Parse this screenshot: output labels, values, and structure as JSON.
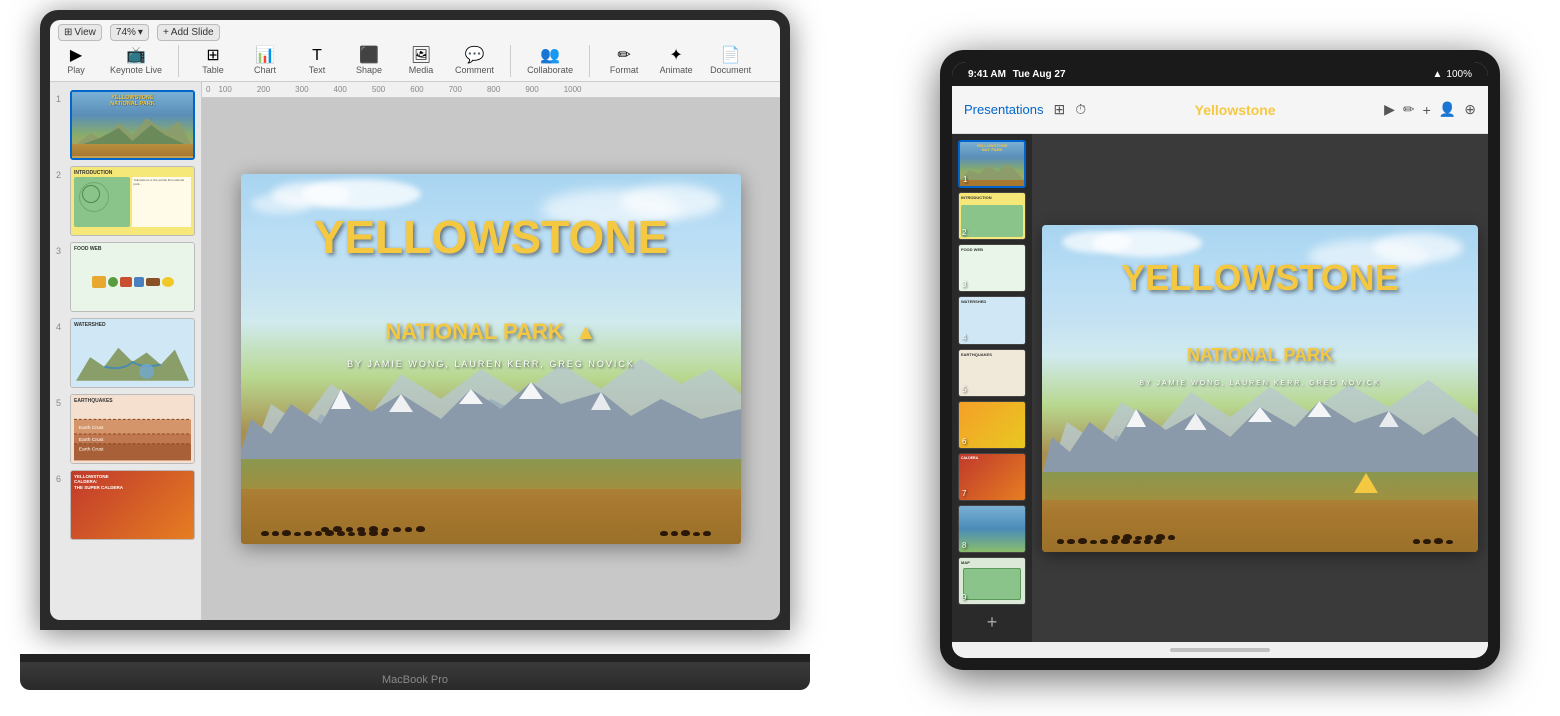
{
  "macbook": {
    "label": "MacBook Pro",
    "toolbar": {
      "view_label": "View",
      "zoom_label": "74%",
      "add_slide_label": "Add Slide",
      "play_label": "Play",
      "keynote_live_label": "Keynote Live",
      "table_label": "Table",
      "chart_label": "Chart",
      "text_label": "Text",
      "shape_label": "Shape",
      "media_label": "Media",
      "comment_label": "Comment",
      "collaborate_label": "Collaborate",
      "format_label": "Format",
      "animate_label": "Animate",
      "document_label": "Document"
    },
    "ruler": {
      "marks": [
        "100",
        "200",
        "300",
        "400",
        "500",
        "600",
        "700",
        "800",
        "900",
        "1000"
      ]
    },
    "slides": [
      {
        "num": "1",
        "label": "YELLOWSTONE NATIONAL PARK",
        "type": "title"
      },
      {
        "num": "2",
        "label": "INTRODUCTION",
        "type": "intro"
      },
      {
        "num": "3",
        "label": "FOOD WEB",
        "type": "food"
      },
      {
        "num": "4",
        "label": "WATERSHED",
        "type": "watershed"
      },
      {
        "num": "5",
        "label": "EARTHQUAKES",
        "type": "earthquakes"
      },
      {
        "num": "6",
        "label": "YELLOWSTONE CALDERA: THE SUPER CALDERA",
        "type": "caldera"
      }
    ],
    "main_slide": {
      "title": "YELLOWSTONE",
      "subtitle": "NATIONAL PARK",
      "triangle": "▲",
      "byline": "BY JAMIE WONG, LAUREN KERR, GREG NOVICK"
    }
  },
  "ipad": {
    "status_bar": {
      "time": "9:41 AM",
      "date": "Tue Aug 27",
      "battery": "100%",
      "wifi": "WiFi"
    },
    "toolbar": {
      "presentations_label": "Presentations",
      "document_title": "Yellowstone"
    },
    "slides": [
      {
        "num": "1",
        "type": "title"
      },
      {
        "num": "2",
        "type": "intro"
      },
      {
        "num": "3",
        "type": "food"
      },
      {
        "num": "4",
        "type": "watershed"
      },
      {
        "num": "5",
        "type": "earthquakes"
      },
      {
        "num": "6",
        "type": "geothermal"
      },
      {
        "num": "7",
        "type": "caldera"
      },
      {
        "num": "8",
        "type": "geothermal2"
      },
      {
        "num": "9",
        "type": "map"
      }
    ],
    "main_slide": {
      "title": "YELLOWSTONE",
      "subtitle": "NATIONAL PARK",
      "triangle": "▲",
      "byline": "BY JAMIE WONG, LAUREN KERR, GREG NOVICK"
    }
  }
}
